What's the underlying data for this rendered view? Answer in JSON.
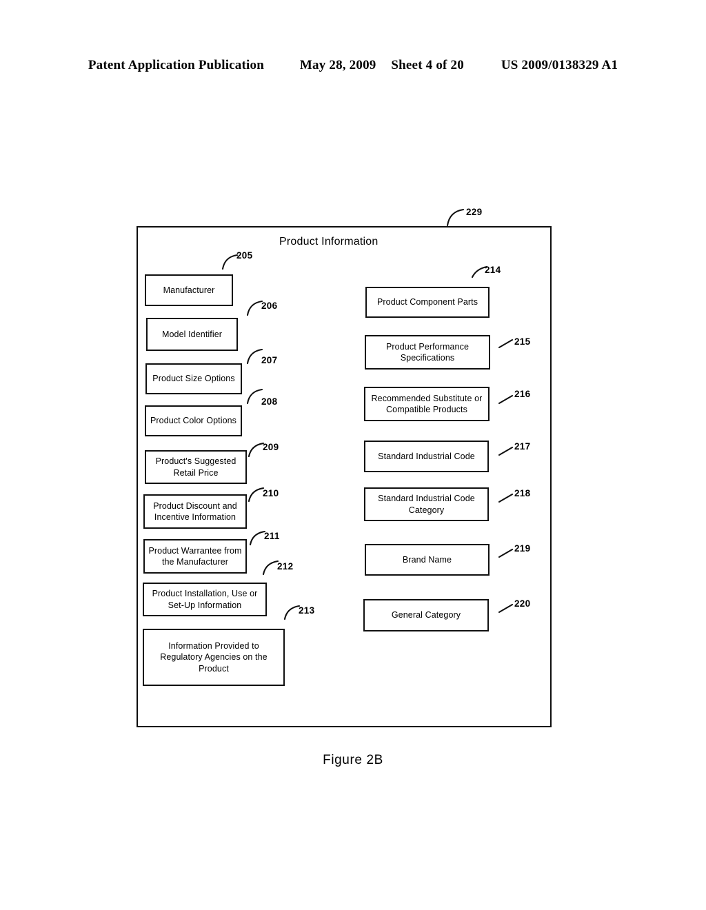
{
  "page_header": {
    "publication": "Patent Application Publication",
    "date": "May 28, 2009",
    "sheet": "Sheet 4 of 20",
    "patent_number": "US 2009/0138329 A1"
  },
  "figure": {
    "caption": "Figure 2B",
    "container_ref": "229",
    "title": "Product Information"
  },
  "left_column": [
    {
      "ref": "205",
      "label": "Manufacturer"
    },
    {
      "ref": "206",
      "label": "Model Identifier"
    },
    {
      "ref": "207",
      "label": "Product Size Options"
    },
    {
      "ref": "208",
      "label": "Product Color Options"
    },
    {
      "ref": "209",
      "label": "Product's Suggested Retail Price"
    },
    {
      "ref": "210",
      "label": "Product Discount and Incentive Information"
    },
    {
      "ref": "211",
      "label": "Product Warrantee from the Manufacturer"
    },
    {
      "ref": "212",
      "label": "Product Installation, Use or Set-Up Information"
    },
    {
      "ref": "213",
      "label": "Information Provided to Regulatory Agencies on the Product"
    }
  ],
  "right_column": [
    {
      "ref": "214",
      "label": "Product Component Parts"
    },
    {
      "ref": "215",
      "label": "Product Performance Specifications"
    },
    {
      "ref": "216",
      "label": "Recommended Substitute or Compatible Products"
    },
    {
      "ref": "217",
      "label": "Standard Industrial Code"
    },
    {
      "ref": "218",
      "label": "Standard Industrial Code Category"
    },
    {
      "ref": "219",
      "label": "Brand Name"
    },
    {
      "ref": "220",
      "label": "General Category"
    }
  ],
  "colors": {
    "ink": "#101010",
    "paper": "#ffffff"
  }
}
